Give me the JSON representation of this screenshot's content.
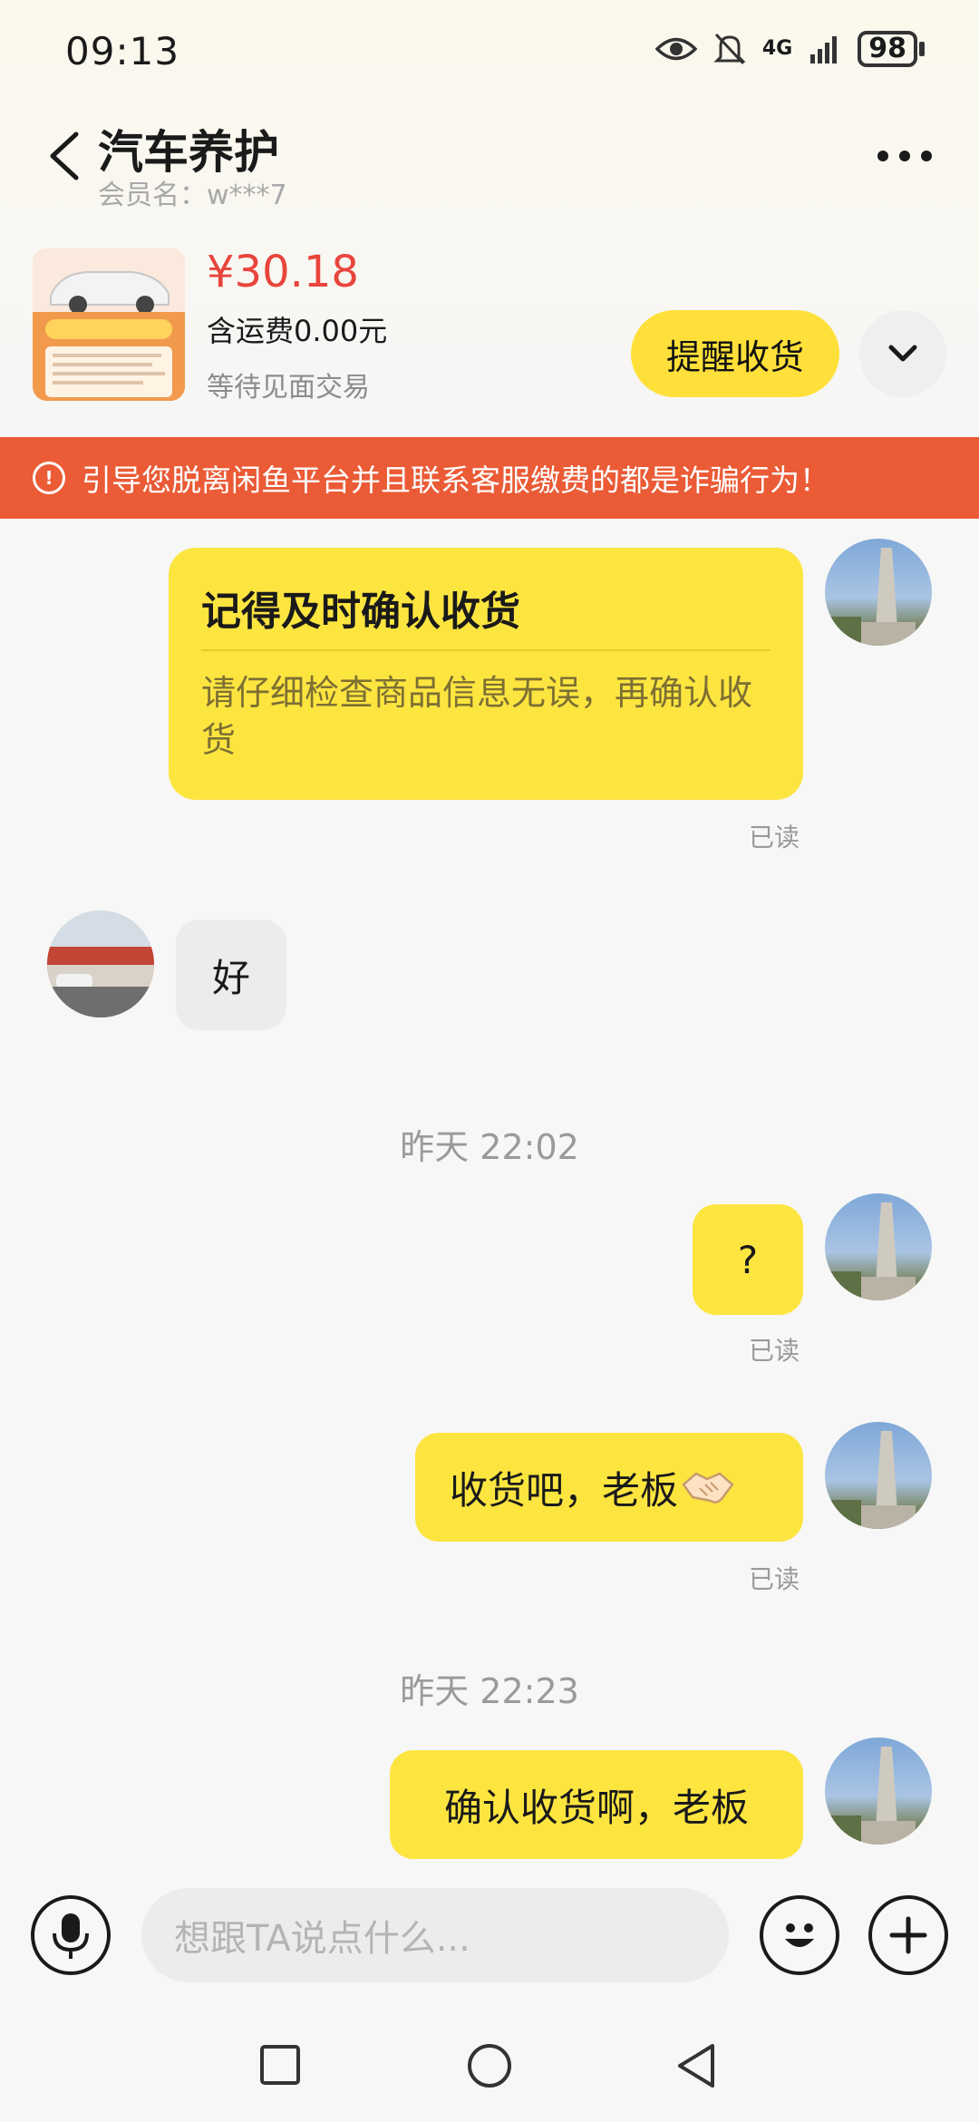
{
  "status": {
    "time": "09:13",
    "net": "4G",
    "battery": "98"
  },
  "header": {
    "title": "汽车养护",
    "subtitle": "会员名：w***7"
  },
  "product": {
    "price": "¥30.18",
    "shipping": "含运费0.00元",
    "state": "等待见面交易",
    "remind_label": "提醒收货"
  },
  "warning": {
    "text": "引导您脱离闲鱼平台并且联系客服缴费的都是诈骗行为！"
  },
  "messages": {
    "card_title": "记得及时确认收货",
    "card_desc": "请仔细检查商品信息无误，再确认收货",
    "read1": "已读",
    "reply_ok": "好",
    "time1": "昨天 22:02",
    "q": "?",
    "read2": "已读",
    "msg_take": "收货吧，老板",
    "read3": "已读",
    "time2": "昨天 22:23",
    "msg_confirm": "确认收货啊，老板"
  },
  "input": {
    "placeholder": "想跟TA说点什么..."
  },
  "colors": {
    "accent": "#fde540",
    "warning": "#ea5b36",
    "price": "#e8453c"
  },
  "icons": [
    "back-icon",
    "more-icon",
    "chevron-down-icon",
    "warning-icon",
    "mic-icon",
    "emoji-icon",
    "plus-icon",
    "nav-square-icon",
    "nav-home-icon",
    "nav-back-icon",
    "eye-icon",
    "bell-off-icon",
    "signal-icon",
    "battery-icon",
    "handshake-icon"
  ]
}
